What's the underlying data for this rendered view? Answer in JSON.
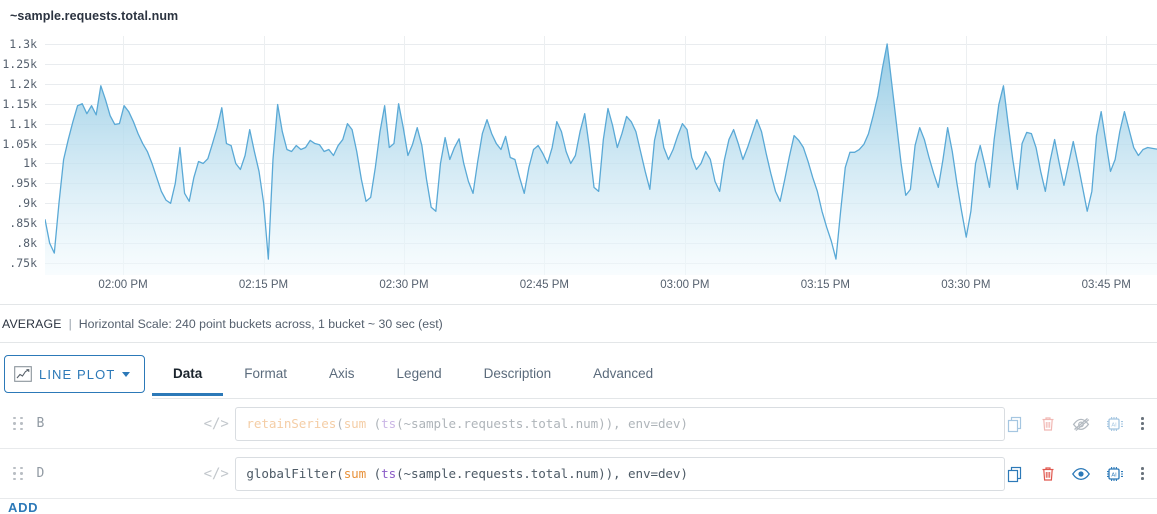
{
  "chart": {
    "title": "~sample.requests.total.num",
    "footer": {
      "aggregation": "AVERAGE",
      "separator": "|",
      "scale_text": "Horizontal Scale: 240 point buckets across, 1 bucket ~ 30 sec (est)"
    }
  },
  "chart_data": {
    "type": "area",
    "title": "~sample.requests.total.num",
    "xlabel": "",
    "ylabel": "",
    "grid": true,
    "legend": "none",
    "line_color": "#5aa9d6",
    "fill_top_color": "#8fc8e3",
    "fill_bottom_color": "#f2fafd",
    "ylim": [
      720,
      1320
    ],
    "ytick_labels": [
      "1.3k",
      "1.25k",
      "1.2k",
      "1.15k",
      "1.1k",
      "1.05k",
      "1k",
      ".95k",
      ".9k",
      ".85k",
      ".8k",
      ".75k"
    ],
    "ytick_values": [
      1300,
      1250,
      1200,
      1150,
      1100,
      1050,
      1000,
      950,
      900,
      850,
      800,
      750
    ],
    "xtick_labels": [
      "02:00 PM",
      "02:15 PM",
      "02:30 PM",
      "02:45 PM",
      "03:00 PM",
      "03:15 PM",
      "03:30 PM",
      "03:45 PM"
    ],
    "xtick_positions": [
      0.0702,
      0.1965,
      0.3228,
      0.4491,
      0.5754,
      0.7018,
      0.8281,
      0.9544
    ],
    "series": [
      {
        "name": "~sample.requests.total.num",
        "values": [
          860,
          800,
          775,
          900,
          1010,
          1060,
          1105,
          1145,
          1150,
          1125,
          1145,
          1122,
          1195,
          1160,
          1120,
          1098,
          1100,
          1145,
          1130,
          1105,
          1075,
          1050,
          1030,
          1000,
          965,
          930,
          908,
          900,
          950,
          1040,
          925,
          905,
          965,
          1005,
          1000,
          1012,
          1050,
          1090,
          1140,
          1050,
          1045,
          1000,
          985,
          1020,
          1085,
          1030,
          980,
          900,
          760,
          1010,
          1148,
          1080,
          1035,
          1030,
          1045,
          1035,
          1040,
          1058,
          1050,
          1047,
          1030,
          1035,
          1020,
          1045,
          1060,
          1100,
          1085,
          1030,
          960,
          905,
          915,
          990,
          1080,
          1145,
          1040,
          1050,
          1150,
          1090,
          1020,
          1048,
          1090,
          1045,
          960,
          890,
          880,
          1000,
          1065,
          1010,
          1040,
          1062,
          1000,
          955,
          925,
          1005,
          1075,
          1110,
          1075,
          1050,
          1035,
          1068,
          1015,
          1010,
          965,
          925,
          990,
          1035,
          1045,
          1025,
          1000,
          1040,
          1105,
          1080,
          1030,
          1000,
          1020,
          1080,
          1125,
          1040,
          940,
          930,
          1060,
          1138,
          1095,
          1040,
          1075,
          1118,
          1105,
          1080,
          1030,
          980,
          935,
          1058,
          1110,
          1040,
          1010,
          1035,
          1070,
          1100,
          1085,
          1015,
          985,
          1000,
          1030,
          1010,
          955,
          930,
          1008,
          1060,
          1085,
          1050,
          1010,
          1040,
          1075,
          1110,
          1080,
          1025,
          975,
          930,
          905,
          960,
          1018,
          1070,
          1058,
          1040,
          1005,
          965,
          930,
          880,
          840,
          805,
          760,
          880,
          990,
          1028,
          1028,
          1035,
          1048,
          1075,
          1120,
          1170,
          1240,
          1300,
          1200,
          1100,
          1000,
          920,
          935,
          1045,
          1090,
          1060,
          1015,
          975,
          940,
          1010,
          1090,
          1030,
          950,
          880,
          815,
          880,
          1000,
          1045,
          995,
          940,
          1060,
          1148,
          1195,
          1100,
          1010,
          935,
          1050,
          1078,
          1075,
          1040,
          980,
          930,
          1005,
          1060,
          1000,
          945,
          1000,
          1055,
          1000,
          940,
          880,
          930,
          1070,
          1130,
          1055,
          980,
          1010,
          1080,
          1130,
          1085,
          1040,
          1020,
          1035,
          1040,
          1038,
          1036
        ]
      }
    ]
  },
  "plot_type": {
    "label": "LINE PLOT",
    "icon": "line-chart-icon"
  },
  "tabs": [
    {
      "label": "Data",
      "active": true
    },
    {
      "label": "Format",
      "active": false
    },
    {
      "label": "Axis",
      "active": false
    },
    {
      "label": "Legend",
      "active": false
    },
    {
      "label": "Description",
      "active": false
    },
    {
      "label": "Advanced",
      "active": false
    }
  ],
  "queries": [
    {
      "letter": "B",
      "code_icon": "</>",
      "visible": false,
      "tokens": [
        {
          "text": "retainSeries",
          "type": "fn"
        },
        {
          "text": "(",
          "type": "plain"
        },
        {
          "text": "sum",
          "type": "agg"
        },
        {
          "text": " (",
          "type": "plain"
        },
        {
          "text": "ts",
          "type": "ts"
        },
        {
          "text": "(~sample.requests.total.num)), env=dev)",
          "type": "plain"
        }
      ],
      "full_text": "retainSeries(sum (ts(~sample.requests.total.num)), env=dev)"
    },
    {
      "letter": "D",
      "code_icon": "</>",
      "visible": true,
      "tokens": [
        {
          "text": "globalFilter",
          "type": "plain"
        },
        {
          "text": "(",
          "type": "plain"
        },
        {
          "text": "sum",
          "type": "agg"
        },
        {
          "text": " (",
          "type": "plain"
        },
        {
          "text": "ts",
          "type": "ts"
        },
        {
          "text": "(~sample.requests.total.num)), env=dev)",
          "type": "plain"
        }
      ],
      "full_text": "globalFilter(sum (ts(~sample.requests.total.num)), env=dev)"
    }
  ],
  "row_actions": {
    "clone": "clone-icon",
    "delete": "trash-icon",
    "toggle_visible": "eye-icon",
    "toggle_hidden": "eye-off-icon",
    "ai": "ai-chip-icon",
    "more": "kebab-menu-icon"
  },
  "add_query_label": "ADD",
  "colors": {
    "accent": "#2c79b8",
    "danger": "#e0574e",
    "line": "#5aa9d6",
    "muted": "#9099a2"
  }
}
